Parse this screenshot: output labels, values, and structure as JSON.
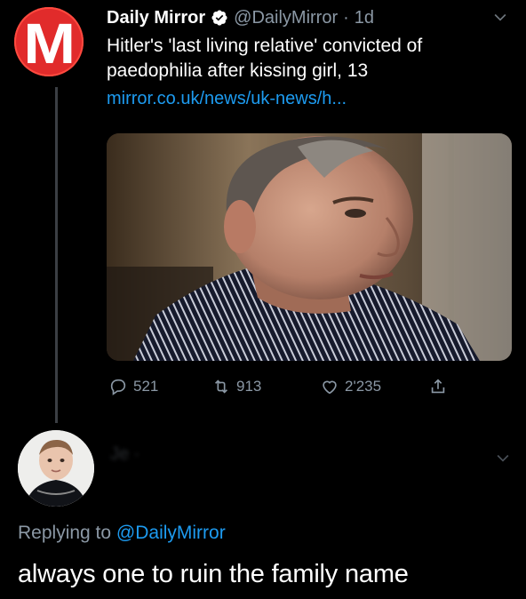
{
  "tweet": {
    "display_name": "Daily Mirror",
    "handle": "@DailyMirror",
    "separator": "·",
    "time": "1d",
    "avatar_letter": "M",
    "text": "Hitler's 'last living relative' convicted of paedophilia after kissing girl, 13",
    "link": "mirror.co.uk/news/uk-news/h...",
    "replies": "521",
    "retweets": "913",
    "likes": "2'235"
  },
  "reply": {
    "replying_prefix": "Replying to ",
    "replying_mention": "@DailyMirror",
    "text": "always one to ruin the family name"
  },
  "colors": {
    "background": "#000000",
    "brand_red": "#e12b2b",
    "link_blue": "#1d9bf0",
    "muted": "#8b98a5"
  },
  "icons": {
    "verified": "verified-badge-icon",
    "chevron": "chevron-down-icon",
    "reply": "reply-icon",
    "retweet": "retweet-icon",
    "like": "heart-icon",
    "share": "share-icon"
  }
}
